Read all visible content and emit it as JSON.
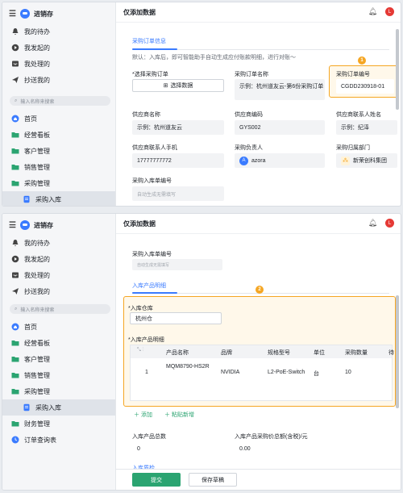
{
  "app": {
    "name": "进销存"
  },
  "page_title": "仅添加数据",
  "avatar_letter": "L",
  "search_placeholder": "输入名称来搜索",
  "nav_top": [
    {
      "label": "我的待办",
      "icon": "bell-icon"
    },
    {
      "label": "我发起的",
      "icon": "play-icon"
    },
    {
      "label": "我处理的",
      "icon": "inbox-icon"
    },
    {
      "label": "抄送我的",
      "icon": "send-icon"
    }
  ],
  "nav_main": [
    {
      "label": "首页",
      "icon": "home-icon"
    },
    {
      "label": "经营看板",
      "icon": "folder-icon"
    },
    {
      "label": "客户管理",
      "icon": "folder-icon"
    },
    {
      "label": "销售管理",
      "icon": "folder-icon"
    },
    {
      "label": "采购管理",
      "icon": "folder-icon"
    },
    {
      "label": "采购入库",
      "icon": "doc-icon"
    },
    {
      "label": "财务管理",
      "icon": "folder-icon"
    },
    {
      "label": "订单查询表",
      "icon": "clock-icon"
    }
  ],
  "panel1": {
    "section_title": "采购订单信息",
    "hint": "默认：入库后，即可智能助手自动生成应付账款明细，进行对账～",
    "fields": {
      "select_order_label": "*选择采购订单",
      "select_btn": "选择数据",
      "order_name_label": "采购订单名称",
      "order_name_value": "示例：杭州道友云-第6份采购订单",
      "order_no_label": "采购订单编号",
      "order_no_value": "CGDD230918-01",
      "supplier_name_label": "供应商名称",
      "supplier_name_value": "示例：杭州道友云",
      "supplier_code_label": "供应商编码",
      "supplier_code_value": "GYS002",
      "supplier_contact_label": "供应商联系人姓名",
      "supplier_contact_value": "示例：纪泽",
      "supplier_phone_label": "供应商联系人手机",
      "supplier_phone_value": "17777777772",
      "purchaser_label": "采购负责人",
      "purchaser_avatar": "A",
      "purchaser_value": "azora",
      "dept_label": "采购归属部门",
      "dept_value": "新荣创科集团",
      "inbound_no_label": "采购入库单编号",
      "inbound_no_placeholder": "自动生成无需填写"
    },
    "badge": "1"
  },
  "panel2": {
    "inbound_no_label": "采购入库单编号",
    "inbound_no_placeholder": "自动生成无需填写",
    "section_title": "入库产品明细",
    "badge": "2",
    "warehouse_label": "*入库仓库",
    "warehouse_value": "杭州仓",
    "detail_label": "*入库产品明细",
    "table_headers": [
      "产品名称",
      "品牌",
      "规格型号",
      "单位",
      "采购数量",
      "待"
    ],
    "table_rows": [
      {
        "index": "1",
        "name": "MQM8790-HS2R",
        "brand": "NVIDIA",
        "model": "L2-PoE-Switch",
        "unit": "台",
        "qty": "10"
      }
    ],
    "add_link": "添加",
    "paste_link": "粘贴新增",
    "total_qty_label": "入库产品总数",
    "total_qty_value": "0",
    "total_amount_label": "入库产品采购价总额(含税)/元",
    "total_amount_value": "0.00",
    "quality_tab": "入库质检",
    "submit_btn": "提交",
    "save_draft_btn": "保存草稿"
  },
  "colors": {
    "accent": "#3a7bff",
    "primary_green": "#2ba471",
    "highlight": "#f5a623",
    "avatar_red": "#e53935"
  }
}
